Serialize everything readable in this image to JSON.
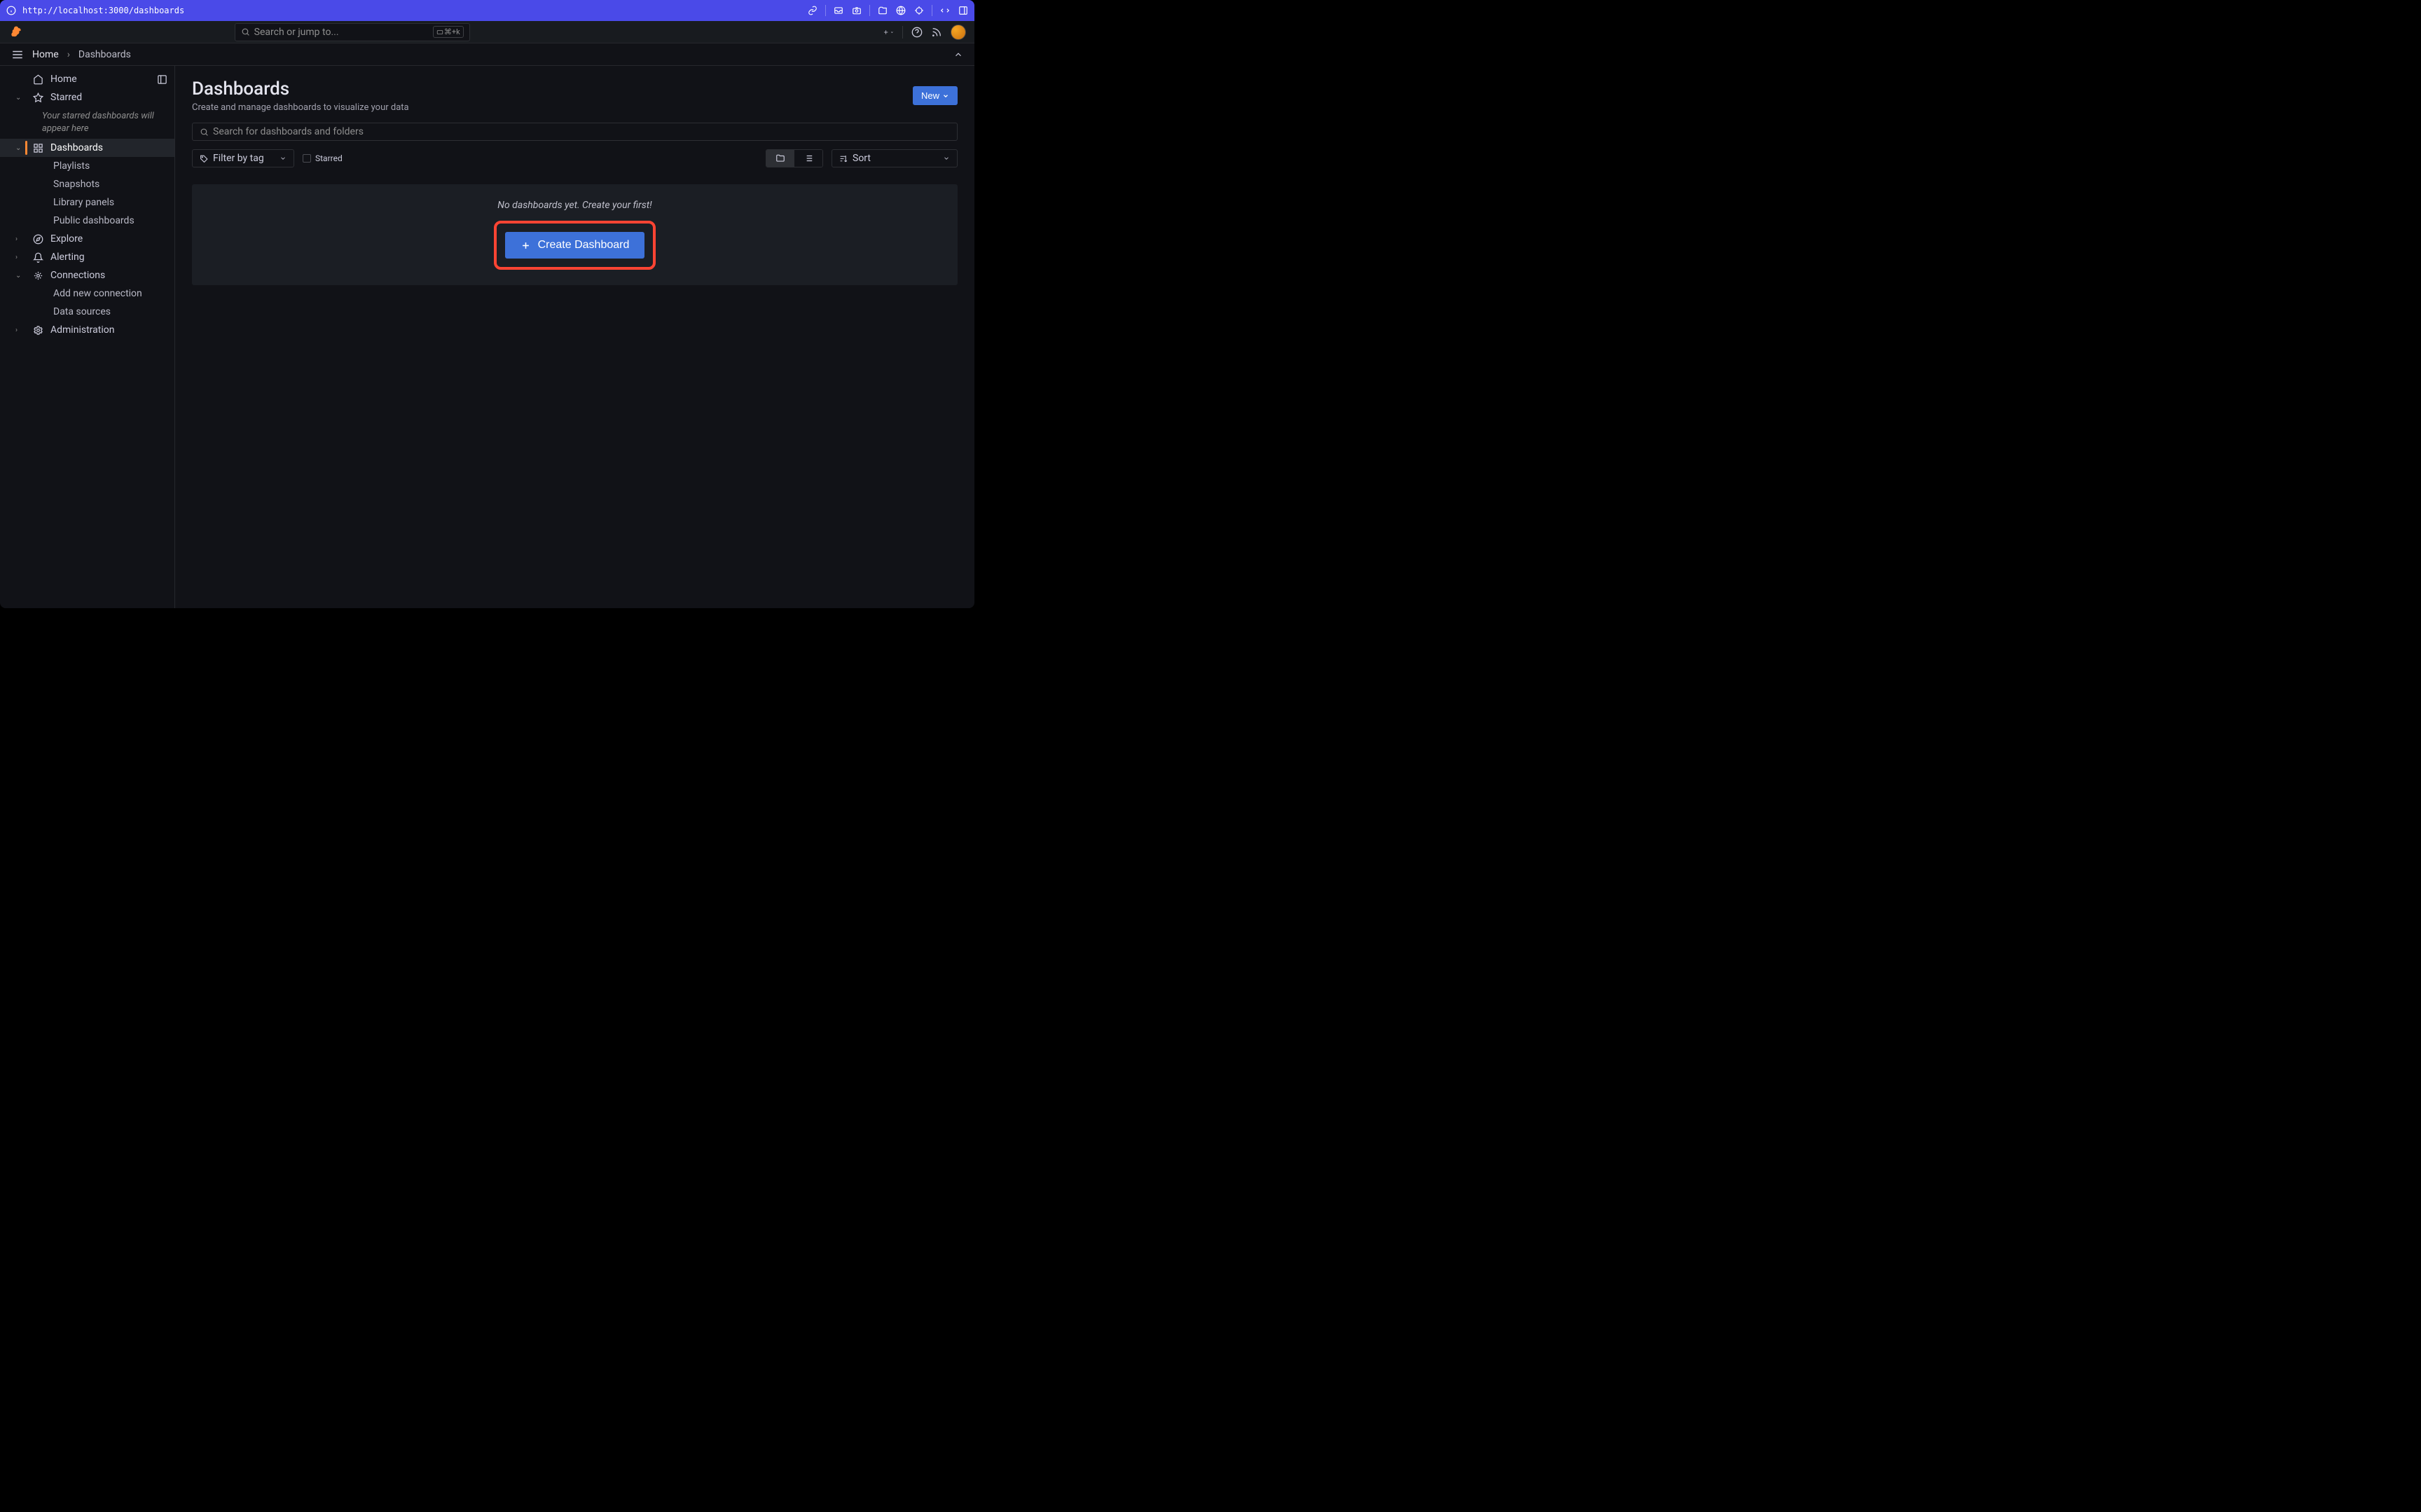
{
  "url_bar": {
    "url": "http://localhost:3000/dashboards"
  },
  "top_bar": {
    "search_placeholder": "Search or jump to...",
    "kbd_shortcut": "⌘+k"
  },
  "breadcrumbs": {
    "home": "Home",
    "current": "Dashboards"
  },
  "sidebar": {
    "home": "Home",
    "starred": "Starred",
    "starred_note": "Your starred dashboards will appear here",
    "dashboards": "Dashboards",
    "dashboards_sub": [
      "Playlists",
      "Snapshots",
      "Library panels",
      "Public dashboards"
    ],
    "explore": "Explore",
    "alerting": "Alerting",
    "connections": "Connections",
    "connections_sub": [
      "Add new connection",
      "Data sources"
    ],
    "administration": "Administration"
  },
  "page": {
    "title": "Dashboards",
    "subtitle": "Create and manage dashboards to visualize your data",
    "new_button": "New",
    "search_placeholder": "Search for dashboards and folders",
    "filter_by_tag": "Filter by tag",
    "starred_label": "Starred",
    "sort_label": "Sort",
    "empty_text": "No dashboards yet. Create your first!",
    "create_button": "Create Dashboard"
  }
}
